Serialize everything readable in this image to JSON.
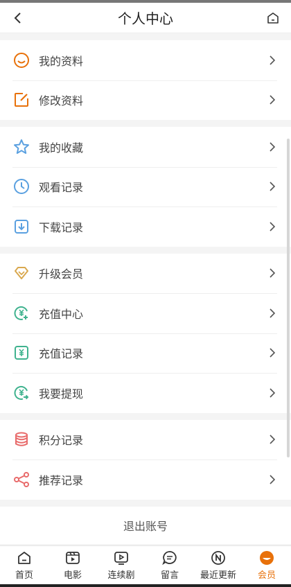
{
  "header": {
    "title": "个人中心"
  },
  "groups": [
    {
      "items": [
        {
          "label": "我的资料",
          "icon": "smile-face-icon"
        },
        {
          "label": "修改资料",
          "icon": "edit-icon"
        }
      ]
    },
    {
      "items": [
        {
          "label": "我的收藏",
          "icon": "star-icon"
        },
        {
          "label": "观看记录",
          "icon": "clock-icon"
        },
        {
          "label": "下载记录",
          "icon": "download-icon"
        }
      ]
    },
    {
      "items": [
        {
          "label": "升级会员",
          "icon": "diamond-icon"
        },
        {
          "label": "充值中心",
          "icon": "yen-coin-plus-icon"
        },
        {
          "label": "充值记录",
          "icon": "yen-square-icon"
        },
        {
          "label": "我要提现",
          "icon": "yen-coin-arrow-icon"
        }
      ]
    },
    {
      "items": [
        {
          "label": "积分记录",
          "icon": "database-icon"
        },
        {
          "label": "推荐记录",
          "icon": "share-icon"
        }
      ]
    }
  ],
  "logout_label": "退出账号",
  "tabs": [
    {
      "label": "首页",
      "icon": "home-icon"
    },
    {
      "label": "电影",
      "icon": "film-icon"
    },
    {
      "label": "连续剧",
      "icon": "tv-play-icon"
    },
    {
      "label": "留言",
      "icon": "message-icon"
    },
    {
      "label": "最近更新",
      "icon": "new-badge-icon"
    },
    {
      "label": "会员",
      "icon": "member-face-icon",
      "active": true
    }
  ],
  "colors": {
    "orange": "#e8710a",
    "blue": "#5aa0e0",
    "gold": "#d9a84e",
    "green": "#3fb28e",
    "red": "#e86b6b"
  }
}
